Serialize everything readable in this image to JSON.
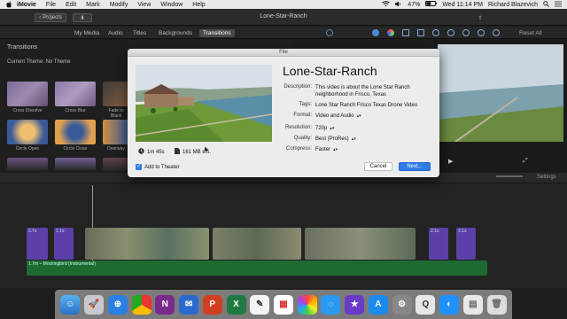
{
  "menubar": {
    "app": "iMovie",
    "items": [
      "File",
      "Edit",
      "Mark",
      "Modify",
      "View",
      "Window",
      "Help"
    ],
    "battery": "47%",
    "clock": "Wed 11:14 PM",
    "user": "Richard Blazevich"
  },
  "toolbar": {
    "projects_label": "Projects",
    "window_title": "Lone-Star-Ranch",
    "reset_all": "Reset All"
  },
  "tabs": [
    "My Media",
    "Audio",
    "Titles",
    "Backgrounds",
    "Transitions"
  ],
  "browser": {
    "heading": "Transitions",
    "theme": "Current Theme: No Theme",
    "transitions": [
      "Cross Dissolve",
      "Cross Blur",
      "Fade to Black",
      "Circle Open",
      "Circle Close",
      "Doorway"
    ]
  },
  "timeline": {
    "settings": "Settings",
    "audio_label": "1.7m – Mockingbird (Instrumental)",
    "clip_labels": [
      "2.7s",
      "1.1s",
      "2.1s",
      "2.1s"
    ]
  },
  "dialog": {
    "window_title": "File",
    "movie_title": "Lone-Star-Ranch",
    "description_label": "Description:",
    "description": "This video is about the Lone Star Ranch neighborhood in Frisco, Texas",
    "tags_label": "Tags:",
    "tags": "Lone Star Ranch Frisco Texas Drone Video",
    "format_label": "Format:",
    "format": "Video and Audio",
    "resolution_label": "Resolution:",
    "resolution": "720p",
    "quality_label": "Quality:",
    "quality": "Best (ProRes)",
    "compress_label": "Compress:",
    "compress": "Faster",
    "duration": "1m 45s",
    "size": "161 MB est.",
    "add_to_theater": "Add to Theater",
    "cancel": "Cancel",
    "next": "Next..."
  },
  "colors": {
    "accent": "#2f7ce8",
    "clip_purple": "#5a40a8",
    "audio_green": "#1e6b32"
  }
}
